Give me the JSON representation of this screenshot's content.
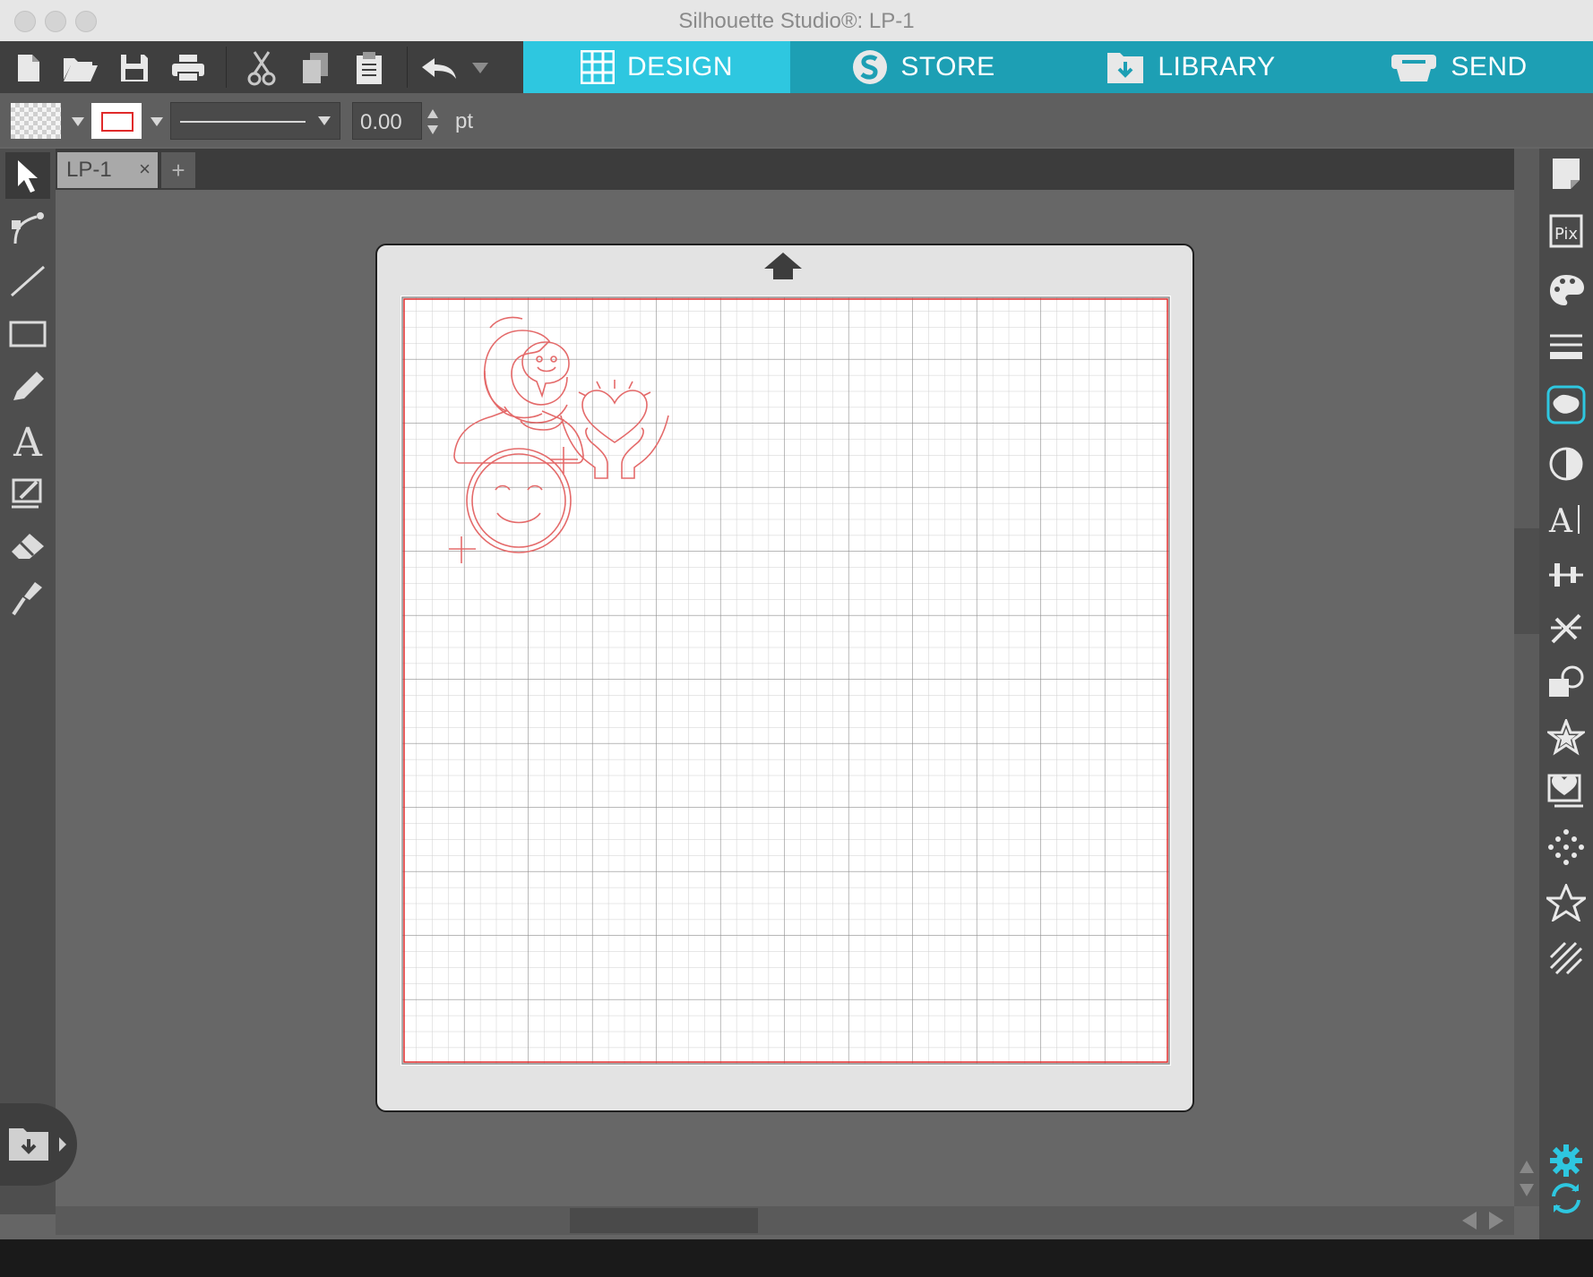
{
  "window": {
    "title": "Silhouette Studio®: LP-1"
  },
  "toolbar": {
    "icons": [
      "new-document-icon",
      "open-folder-icon",
      "save-icon",
      "print-icon",
      "cut-icon",
      "copy-icon",
      "paste-icon",
      "undo-icon",
      "undo-dropdown-icon"
    ]
  },
  "nav_tabs": [
    {
      "label": "DESIGN",
      "icon": "grid-icon",
      "active": true
    },
    {
      "label": "STORE",
      "icon": "silhouette-s-icon",
      "active": false
    },
    {
      "label": "LIBRARY",
      "icon": "library-download-icon",
      "active": false
    },
    {
      "label": "SEND",
      "icon": "cutter-icon",
      "active": false
    }
  ],
  "colors": {
    "accent_active": "#2ec7e0",
    "accent": "#1d9fb4",
    "cut_line": "#e46a6a",
    "mat_border": "#e02a2a"
  },
  "properties": {
    "line_width": "0.00",
    "unit": "pt"
  },
  "document": {
    "tab_name": "LP-1",
    "close_symbol": "×",
    "add_symbol": "+"
  },
  "left_tools": [
    "select-arrow-icon",
    "point-edit-icon",
    "line-tool-icon",
    "rectangle-tool-icon",
    "pencil-tool-icon",
    "text-tool-icon",
    "sketch-tool-icon",
    "eraser-tool-icon",
    "knife-tool-icon"
  ],
  "right_panels": [
    "page-setup-icon",
    "pixscan-icon",
    "fill-panel-icon",
    "line-style-icon",
    "trace-icon",
    "contrast-icon",
    "text-style-icon",
    "align-icon",
    "replicate-icon",
    "modify-icon",
    "offset-icon",
    "rhinestone-icon",
    "transform-icon",
    "sketch-effects-icon",
    "favorites-star-icon",
    "hatch-icon",
    "settings-gear-icon",
    "sync-icon"
  ]
}
